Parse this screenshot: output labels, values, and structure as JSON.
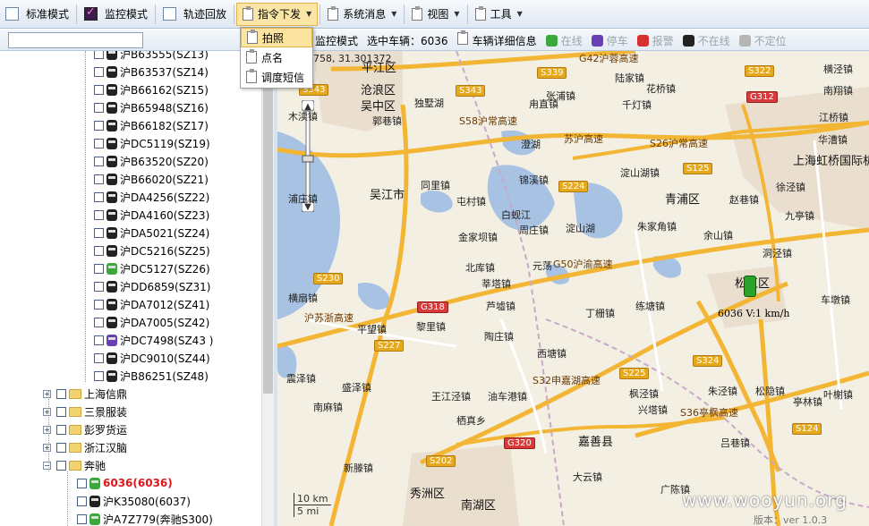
{
  "toolbar": {
    "items": [
      {
        "label": "标准模式",
        "checked": false
      },
      {
        "label": "监控模式",
        "checked": true
      },
      {
        "label": "轨迹回放",
        "checked": false
      }
    ],
    "menus": [
      "指令下发",
      "系统消息",
      "视图",
      "工具"
    ]
  },
  "dropdown": {
    "items": [
      "拍照",
      "点名",
      "调度短信"
    ],
    "selected": 0
  },
  "toolbar2": {
    "search_placeholder": "",
    "mode": "监控模式",
    "selected_vehicle": "选中车辆：6036",
    "detail": "车辆详细信息",
    "status_legend": [
      {
        "label": "在线",
        "color": "#3aa83a"
      },
      {
        "label": "停车",
        "color": "#6a3fb5"
      },
      {
        "label": "报警",
        "color": "#d63030"
      },
      {
        "label": "不在线",
        "color": "#222222"
      },
      {
        "label": "不定位",
        "color": "#b5b5b5"
      }
    ]
  },
  "tree": {
    "vehicles": [
      {
        "label": "沪B63555(SZ13)",
        "color": "#222"
      },
      {
        "label": "沪B63537(SZ14)",
        "color": "#222"
      },
      {
        "label": "沪B66162(SZ15)",
        "color": "#222"
      },
      {
        "label": "沪B65948(SZ16)",
        "color": "#222"
      },
      {
        "label": "沪B66182(SZ17)",
        "color": "#222"
      },
      {
        "label": "沪DC5119(SZ19)",
        "color": "#222"
      },
      {
        "label": "沪B63520(SZ20)",
        "color": "#222"
      },
      {
        "label": "沪B66020(SZ21)",
        "color": "#222"
      },
      {
        "label": "沪DA4256(SZ22)",
        "color": "#222"
      },
      {
        "label": "沪DA4160(SZ23)",
        "color": "#222"
      },
      {
        "label": "沪DA5021(SZ24)",
        "color": "#222"
      },
      {
        "label": "沪DC5216(SZ25)",
        "color": "#222"
      },
      {
        "label": "沪DC5127(SZ26)",
        "color": "#3aa83a"
      },
      {
        "label": "沪DD6859(SZ31)",
        "color": "#222"
      },
      {
        "label": "沪DA7012(SZ41)",
        "color": "#222"
      },
      {
        "label": "沪DA7005(SZ42)",
        "color": "#222"
      },
      {
        "label": "沪DC7498(SZ43 )",
        "color": "#6a3fb5"
      },
      {
        "label": "沪DC9010(SZ44)",
        "color": "#222"
      },
      {
        "label": "沪B86251(SZ48)",
        "color": "#222"
      }
    ],
    "groups": [
      "上海信鼎",
      "三景服装",
      "彭罗货运",
      "浙江汉脑",
      "奔驰"
    ],
    "subvehicles": [
      {
        "label": "6036(6036)",
        "color": "#3aa83a",
        "highlight": true
      },
      {
        "label": "沪K35080(6037)",
        "color": "#222",
        "highlight": false
      },
      {
        "label": "沪A7Z779(奔驰S300)",
        "color": "#3aa83a",
        "highlight": false
      }
    ]
  },
  "map": {
    "coord_fragment": "758, 31.301372",
    "vehicle_label": "6036 V:1 km/h",
    "scale_km": "10 km",
    "scale_mi": "5 mi",
    "watermark": "www.wooyun.org",
    "version": "版本：ver 1.0.3",
    "places": [
      "平江区",
      "沧浪区",
      "吴中区",
      "独墅湖",
      "郭巷镇",
      "甪直镇",
      "陆家镇",
      "花桥镇",
      "南翔镇",
      "张浦镇",
      "千灯镇",
      "江桥镇",
      "澄湖",
      "华漕镇",
      "锦溪镇",
      "淀山湖镇",
      "上海虹桥国际机场",
      "吴江市",
      "同里镇",
      "屯村镇",
      "白蚬江",
      "周庄镇",
      "青浦区",
      "赵巷镇",
      "徐泾镇",
      "金家坝镇",
      "淀山湖",
      "朱家角镇",
      "九亭镇",
      "余山镇",
      "北库镇",
      "元荡",
      "洞泾镇",
      "莘塔镇",
      "松江区",
      "横扇镇",
      "芦墟镇",
      "丁栅镇",
      "练塘镇",
      "车墩镇",
      "平望镇",
      "黎里镇",
      "陶庄镇",
      "西塘镇",
      "震泽镇",
      "盛泽镇",
      "王江泾镇",
      "油车港镇",
      "枫泾镇",
      "朱泾镇",
      "松隐镇",
      "南麻镇",
      "栖真乡",
      "嘉善县",
      "兴塔镇",
      "吕巷镇",
      "亭林镇",
      "新滕镇",
      "秀洲区",
      "南湖区",
      "大云镇",
      "广陈镇",
      "叶榭镇",
      "横泾镇",
      "木渎镇",
      "浦庄镇"
    ]
  }
}
